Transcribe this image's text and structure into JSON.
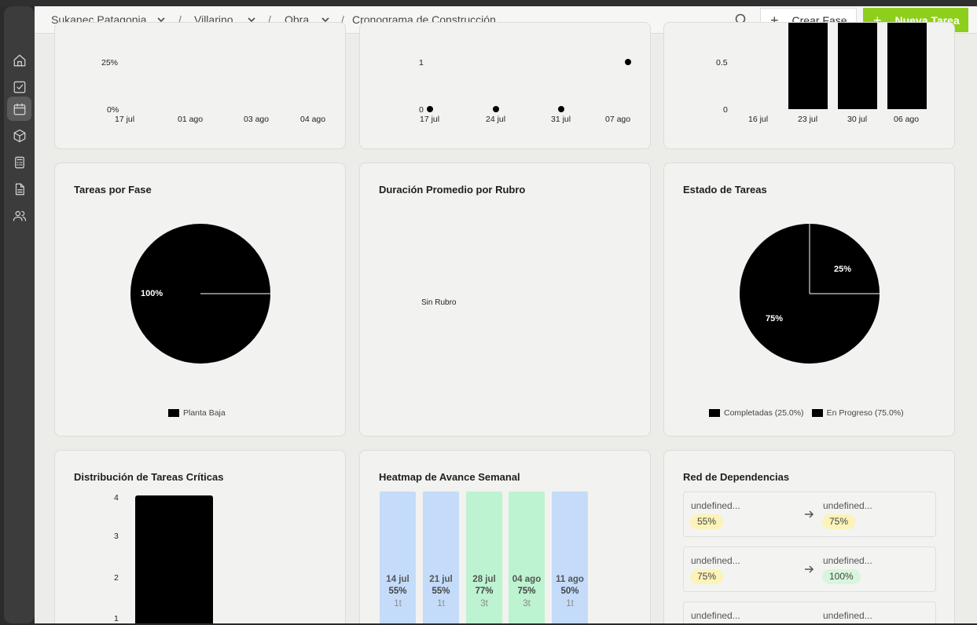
{
  "breadcrumb": {
    "org": "Sukanec Patagonia",
    "project": "Villarino",
    "section": "Obra",
    "page": "Cronograma de Construcción",
    "separator": "/"
  },
  "actions": {
    "create_phase": "Crear Fase",
    "new_task": "Nueva Tarea"
  },
  "sidebar": {
    "items": [
      {
        "icon": "home-icon"
      },
      {
        "icon": "checkbox-icon"
      },
      {
        "icon": "calendar-icon",
        "active": true
      },
      {
        "icon": "cube-icon"
      },
      {
        "icon": "calculator-icon"
      },
      {
        "icon": "document-icon"
      },
      {
        "icon": "users-icon"
      }
    ]
  },
  "top_charts": {
    "progress": {
      "y_ticks": [
        "25%",
        "0%"
      ],
      "x_ticks": [
        "17 jul",
        "01 ago",
        "03 ago",
        "04 ago"
      ]
    },
    "scatter": {
      "y_ticks": [
        "1",
        "0"
      ],
      "x_ticks": [
        "17 jul",
        "24 jul",
        "31 jul",
        "07 ago"
      ]
    },
    "weekly_bars": {
      "y_ticks": [
        "0.5",
        "0"
      ],
      "x_ticks": [
        "16 jul",
        "23 jul",
        "30 jul",
        "06 ago"
      ]
    }
  },
  "tareas_fase": {
    "title": "Tareas por Fase",
    "slice_label": "100%",
    "legend": "Planta Baja"
  },
  "duracion": {
    "title": "Duración Promedio por Rubro",
    "category": "Sin Rubro"
  },
  "estado": {
    "title": "Estado de Tareas",
    "label_small": "25%",
    "label_large": "75%",
    "legend": [
      "Completadas (25.0%)",
      "En Progreso (75.0%)"
    ]
  },
  "criticas": {
    "title": "Distribución de Tareas Críticas",
    "y_ticks": [
      "4",
      "3",
      "2",
      "1"
    ]
  },
  "heatmap": {
    "title": "Heatmap de Avance Semanal",
    "weeks": [
      {
        "week": "14 jul",
        "pct": "55%",
        "tasks": "1t",
        "color": "#c4dcfa"
      },
      {
        "week": "21 jul",
        "pct": "55%",
        "tasks": "1t",
        "color": "#c4dcfa"
      },
      {
        "week": "28 jul",
        "pct": "77%",
        "tasks": "3t",
        "color": "#bdf3d0"
      },
      {
        "week": "04 ago",
        "pct": "75%",
        "tasks": "3t",
        "color": "#bdf3d0"
      },
      {
        "week": "11 ago",
        "pct": "50%",
        "tasks": "1t",
        "color": "#c4dcfa"
      }
    ]
  },
  "dependencias": {
    "title": "Red de Dependencias",
    "rows": [
      {
        "from": "undefined...",
        "from_pct": "55%",
        "from_color": "#fbf3b9",
        "to": "undefined...",
        "to_pct": "75%",
        "to_color": "#fbf3b9"
      },
      {
        "from": "undefined...",
        "from_pct": "75%",
        "from_color": "#fbf3b9",
        "to": "undefined...",
        "to_pct": "100%",
        "to_color": "#d8f5dd"
      },
      {
        "from": "undefined...",
        "from_pct": "",
        "from_color": "#fbf3b9",
        "to": "undefined...",
        "to_pct": "",
        "to_color": "#fbf3b9"
      }
    ]
  },
  "chart_data": [
    {
      "type": "line",
      "x": [
        "17 jul",
        "01 ago",
        "03 ago",
        "04 ago"
      ],
      "y_ticks": [
        "0%",
        "25%"
      ]
    },
    {
      "type": "scatter",
      "x": [
        "17 jul",
        "24 jul",
        "31 jul",
        "07 ago"
      ],
      "values": [
        0,
        0,
        0,
        1
      ],
      "ylim": [
        0,
        1
      ]
    },
    {
      "type": "bar",
      "categories": [
        "16 jul",
        "23 jul",
        "30 jul",
        "06 ago"
      ],
      "values": [
        0,
        1,
        1,
        1
      ]
    },
    {
      "type": "pie",
      "title": "Tareas por Fase",
      "categories": [
        "Planta Baja"
      ],
      "values": [
        100
      ]
    },
    {
      "type": "bar",
      "title": "Duración Promedio por Rubro",
      "categories": [
        "Sin Rubro"
      ]
    },
    {
      "type": "pie",
      "title": "Estado de Tareas",
      "categories": [
        "Completadas",
        "En Progreso"
      ],
      "values": [
        25,
        75
      ]
    },
    {
      "type": "bar",
      "title": "Distribución de Tareas Críticas",
      "categories": [
        ""
      ],
      "values": [
        4
      ]
    }
  ]
}
